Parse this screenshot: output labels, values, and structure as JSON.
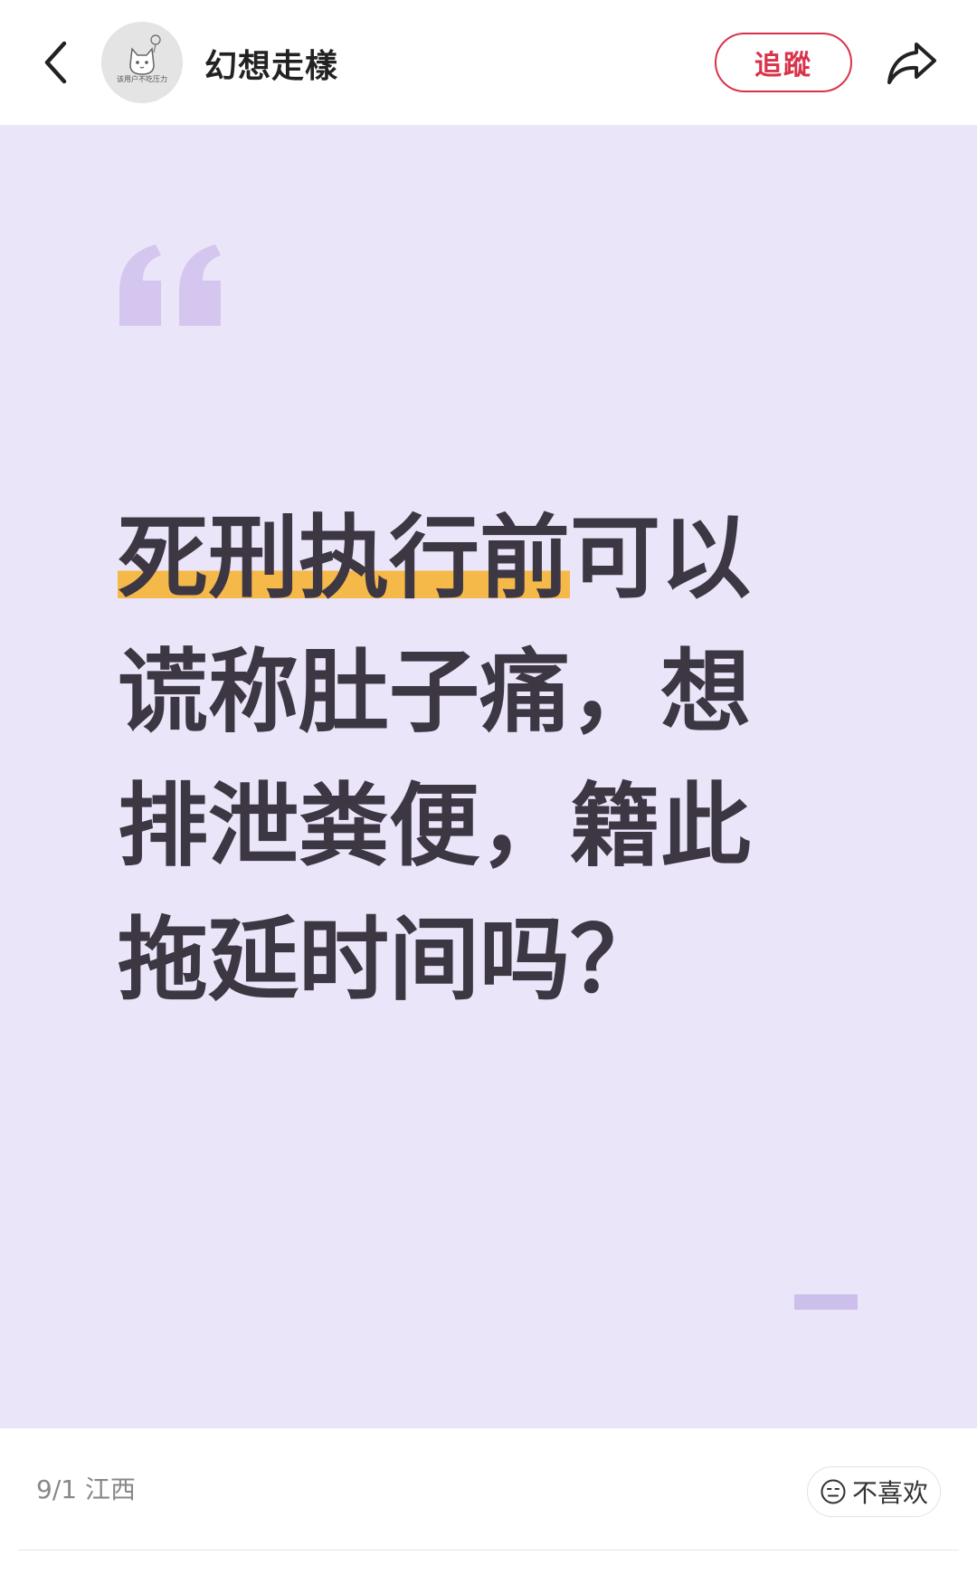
{
  "header": {
    "author_name": "幻想走樣",
    "avatar_caption": "该用户不吃压力",
    "follow_label": "追蹤"
  },
  "post": {
    "headline_line1_highlight": "死刑执行前",
    "headline_line1_rest": "可以",
    "headline_line2": "谎称肚子痛，想",
    "headline_line3": "排泄粪便，籍此",
    "headline_line4": "拖延时间吗？",
    "highlight_color": "#f5b94a",
    "background_color": "#ebe5f9",
    "quote_color": "#d4c6ef"
  },
  "footer": {
    "date_location": "9/1 江西",
    "dislike_label": "不喜欢"
  },
  "icons": {
    "back": "back-arrow-icon",
    "share": "share-arrow-icon",
    "quote": "quotation-mark-icon",
    "dislike": "neutral-face-icon"
  }
}
